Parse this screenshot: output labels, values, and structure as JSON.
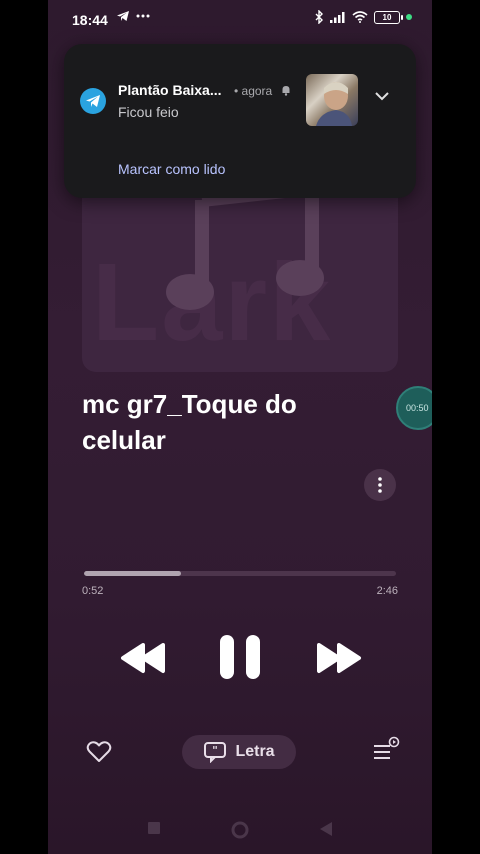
{
  "status_bar": {
    "time": "18:44",
    "battery": "10",
    "icons": [
      "telegram-icon",
      "more-dots-icon",
      "bluetooth-icon",
      "signal-icon",
      "wifi-icon",
      "battery-icon"
    ]
  },
  "notification": {
    "app_icon": "telegram-icon",
    "title": "Plantão Baixa...",
    "time": "• agora",
    "message": "Ficou feio",
    "action_label": "Marcar como lido"
  },
  "album": {
    "watermark": "Lark"
  },
  "song": {
    "title": "mc gr7_Toque do celular"
  },
  "floating_timer": "00:50",
  "player": {
    "current_time": "0:52",
    "total_time": "2:46",
    "progress": 0.31
  },
  "actions": {
    "lyrics_label": "Letra"
  },
  "colors": {
    "background": "#311b31",
    "accent": "#2aa3e0",
    "action": "#b9c4ff"
  }
}
